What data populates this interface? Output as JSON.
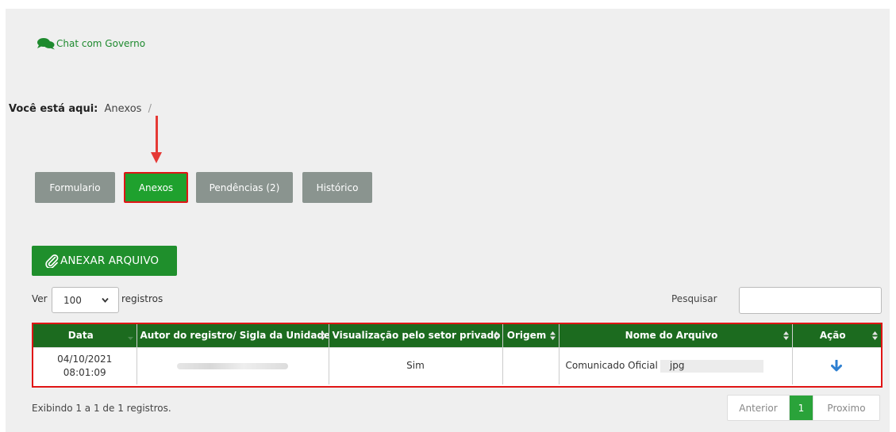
{
  "chat": {
    "label": "Chat com Governo",
    "icon": "chat-bubbles-icon"
  },
  "breadcrumb": {
    "label": "Você está aqui:",
    "current": "Anexos",
    "separator": "/"
  },
  "tabs": [
    {
      "label": "Formulario"
    },
    {
      "label": "Anexos",
      "active": true
    },
    {
      "label": "Pendências (2)"
    },
    {
      "label": "Histórico"
    }
  ],
  "attach_button": {
    "label": "ANEXAR ARQUIVO",
    "icon": "paperclip-icon"
  },
  "length_control": {
    "prefix": "Ver",
    "value": "100",
    "suffix": "registros"
  },
  "search": {
    "label": "Pesquisar",
    "value": ""
  },
  "table": {
    "columns": [
      "Data",
      "Autor do registro/ Sigla da Unidade",
      "Visualização pelo setor privado",
      "Origem",
      "Nome do Arquivo",
      "Ação"
    ],
    "rows": [
      {
        "date": "04/10/2021",
        "time": "08:01:09",
        "author": "",
        "visibility": "Sim",
        "origin": "",
        "file_prefix": "Comunicado Oficial",
        "file_suffix": "jpg",
        "action_icon": "download-arrow-icon"
      }
    ]
  },
  "footer": {
    "info": "Exibindo 1 a 1 de 1 registros.",
    "prev": "Anterior",
    "current_page": "1",
    "next": "Proximo"
  },
  "colors": {
    "primary_green": "#1f8f2c",
    "header_green": "#1c6b1f",
    "tab_gray": "#8a948f",
    "highlight_red": "#e01515"
  }
}
